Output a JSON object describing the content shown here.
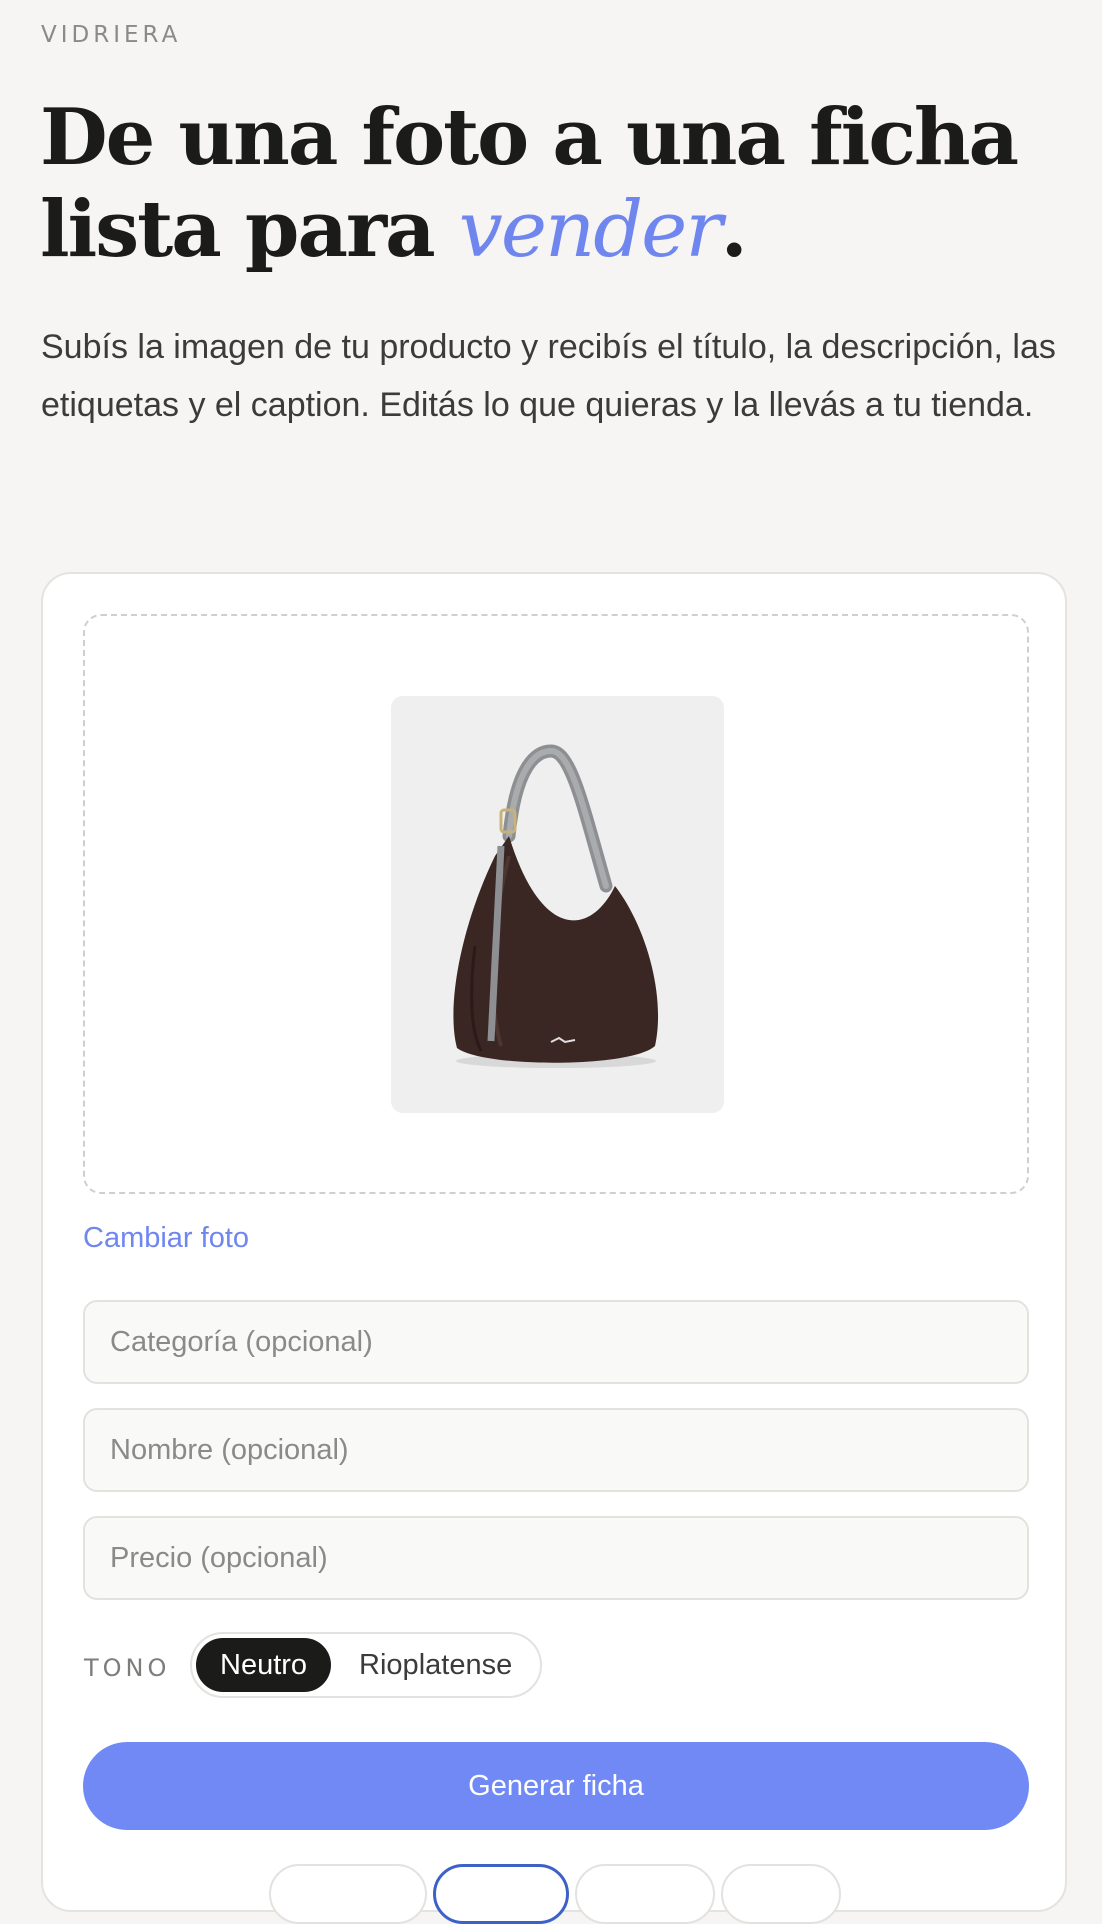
{
  "header": {
    "eyebrow": "VIDRIERA",
    "headline_line1": "De una foto a una ficha",
    "headline_line2_prefix": "lista para ",
    "headline_accent": "vender",
    "headline_suffix": ".",
    "lead": "Subís la imagen de tu producto y recibís el título, la descripción, las etiquetas y el caption. Editás lo que quieras y la llevás a tu tienda."
  },
  "upload": {
    "change_photo_label": "Cambiar foto",
    "image_subject": "brown-leather-hobo-bag"
  },
  "form": {
    "category_placeholder": "Categoría (opcional)",
    "name_placeholder": "Nombre (opcional)",
    "price_placeholder": "Precio (opcional)",
    "category_value": "",
    "name_value": "",
    "price_value": ""
  },
  "tone": {
    "label": "TONO",
    "options": [
      "Neutro",
      "Rioplatense"
    ],
    "selected": "Neutro"
  },
  "actions": {
    "generate_label": "Generar ficha"
  },
  "colors": {
    "accent": "#6f86ef",
    "button": "#7189f4",
    "background": "#f6f5f3",
    "selected_segment": "#1b1b1a"
  }
}
